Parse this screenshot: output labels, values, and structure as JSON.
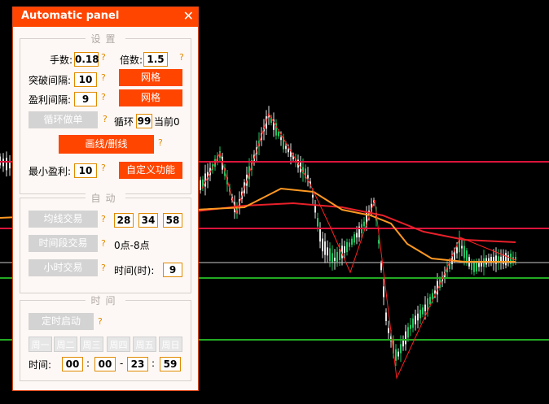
{
  "panel": {
    "title": "Automatic panel",
    "close_symbol": "✕",
    "accent_color": "#ff4500",
    "help_symbol": "?"
  },
  "settings": {
    "legend": "设置",
    "lots_label": "手数:",
    "lots_value": "0.18",
    "multiplier_label": "倍数:",
    "multiplier_value": "1.5",
    "breakout_label": "突破间隔:",
    "breakout_value": "10",
    "breakout_button": "网格",
    "profit_label": "盈利间隔:",
    "profit_value": "9",
    "profit_button": "网格",
    "cycle_button": "循环做单",
    "cycle_label": "循环",
    "cycle_value": "99",
    "current_label": "当前0",
    "draw_button": "画线/删线",
    "min_profit_label": "最小盈利:",
    "min_profit_value": "10",
    "custom_button": "自定义功能"
  },
  "auto": {
    "legend": "自动",
    "ma_button": "均线交易",
    "ma_values": [
      "28",
      "34",
      "58"
    ],
    "period_button": "时间段交易",
    "period_text": "0点-8点",
    "hour_button": "小时交易",
    "hour_label": "时间(时):",
    "hour_value": "9"
  },
  "time": {
    "legend": "时间",
    "timer_button": "定时启动",
    "days": [
      "周一",
      "周二",
      "周三",
      "周四",
      "周五",
      "周日"
    ],
    "time_label": "时间:",
    "start_hour": "00",
    "start_min": "00",
    "end_hour": "23",
    "end_min": "59",
    "colon": ":",
    "dash": "-"
  },
  "chart": {
    "background": "#000000",
    "up_candle_color": "#22c55e",
    "down_candle_color": "#e5e5e5",
    "zigzag_color": "#ff2020",
    "ma_fast_color": "#ff9922",
    "ma_slow_color": "#e8202a",
    "hline_red_color": "#dc143c",
    "hline_green_color": "#22aa22",
    "hline_white_color": "#cccccc"
  }
}
